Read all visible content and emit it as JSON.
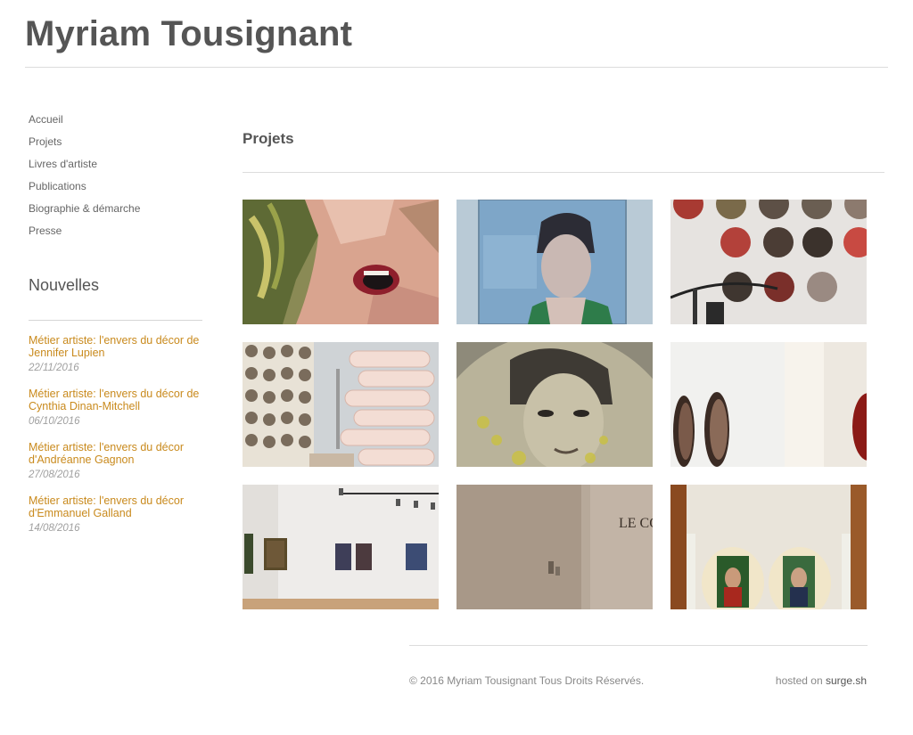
{
  "site": {
    "title": "Myriam Tousignant"
  },
  "nav": {
    "items": [
      {
        "label": "Accueil"
      },
      {
        "label": "Projets"
      },
      {
        "label": "Livres d'artiste"
      },
      {
        "label": "Publications"
      },
      {
        "label": "Biographie & démarche"
      },
      {
        "label": "Presse"
      }
    ]
  },
  "news": {
    "title": "Nouvelles",
    "items": [
      {
        "title": "Métier artiste: l'envers du décor de Jennifer Lupien",
        "date": "22/11/2016"
      },
      {
        "title": "Métier artiste: l'envers du décor de Cynthia Dinan-Mitchell",
        "date": "06/10/2016"
      },
      {
        "title": "Métier artiste: l'envers du décor d'Andréanne Gagnon",
        "date": "27/08/2016"
      },
      {
        "title": "Métier artiste: l'envers du décor d'Emmanuel Galland",
        "date": "14/08/2016"
      }
    ]
  },
  "main": {
    "title": "Projets",
    "gallery_texts": {
      "wall_text": "LE CORP"
    }
  },
  "footer": {
    "copyright": "© 2016 Myriam Tousignant Tous Droits Réservés.",
    "hosted_prefix": "hosted on",
    "hosted_link": "surge.sh"
  },
  "colors": {
    "news_link": "#c98a1d",
    "text": "#555555",
    "rule": "#dcdcdc"
  }
}
